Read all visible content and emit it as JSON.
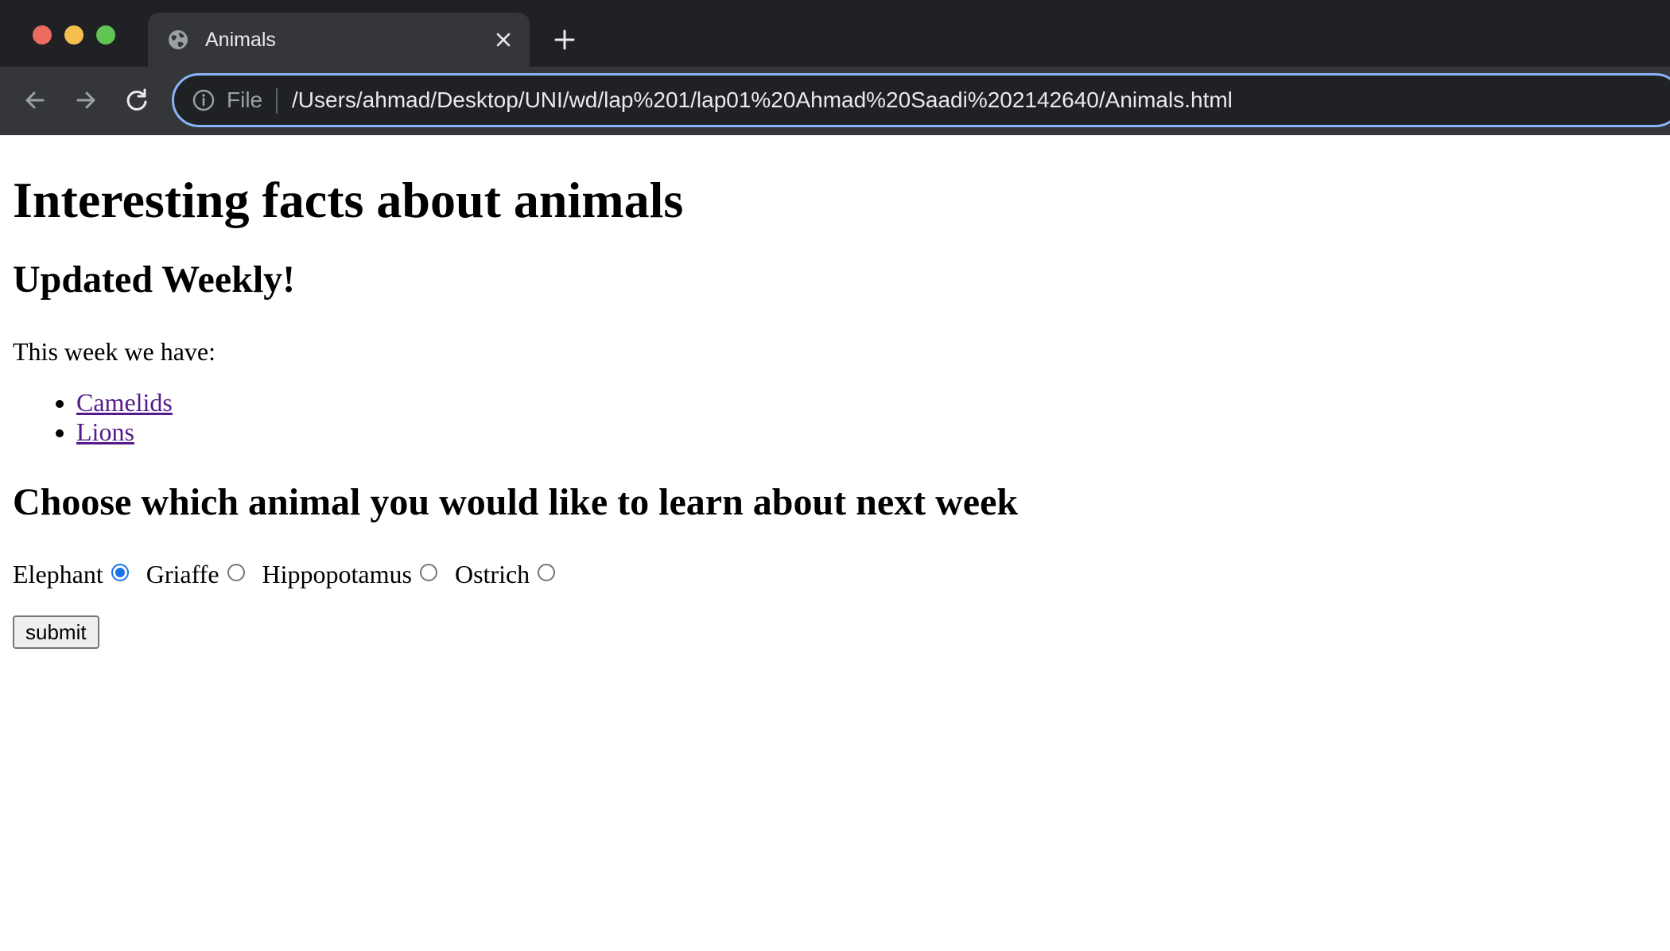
{
  "browser": {
    "tab_title": "Animals",
    "address_scheme": "File",
    "url": "/Users/ahmad/Desktop/UNI/wd/lap%201/lap01%20Ahmad%20Saadi%202142640/Animals.html",
    "accent_color": "#8ab4f8",
    "icons": [
      "globe-icon",
      "close-icon",
      "plus-icon",
      "back-arrow-icon",
      "forward-arrow-icon",
      "reload-icon",
      "info-icon"
    ]
  },
  "page": {
    "title": "Interesting facts about animals",
    "subtitle": "Updated Weekly!",
    "intro": "This week we have:",
    "links": [
      {
        "label": "Camelids"
      },
      {
        "label": "Lions"
      }
    ],
    "poll_heading": "Choose which animal you would like to learn about next week",
    "options": [
      {
        "label": "Elephant",
        "checked": true
      },
      {
        "label": "Griaffe",
        "checked": false
      },
      {
        "label": "Hippopotamus",
        "checked": false
      },
      {
        "label": "Ostrich",
        "checked": false
      }
    ],
    "submit_label": "submit"
  }
}
